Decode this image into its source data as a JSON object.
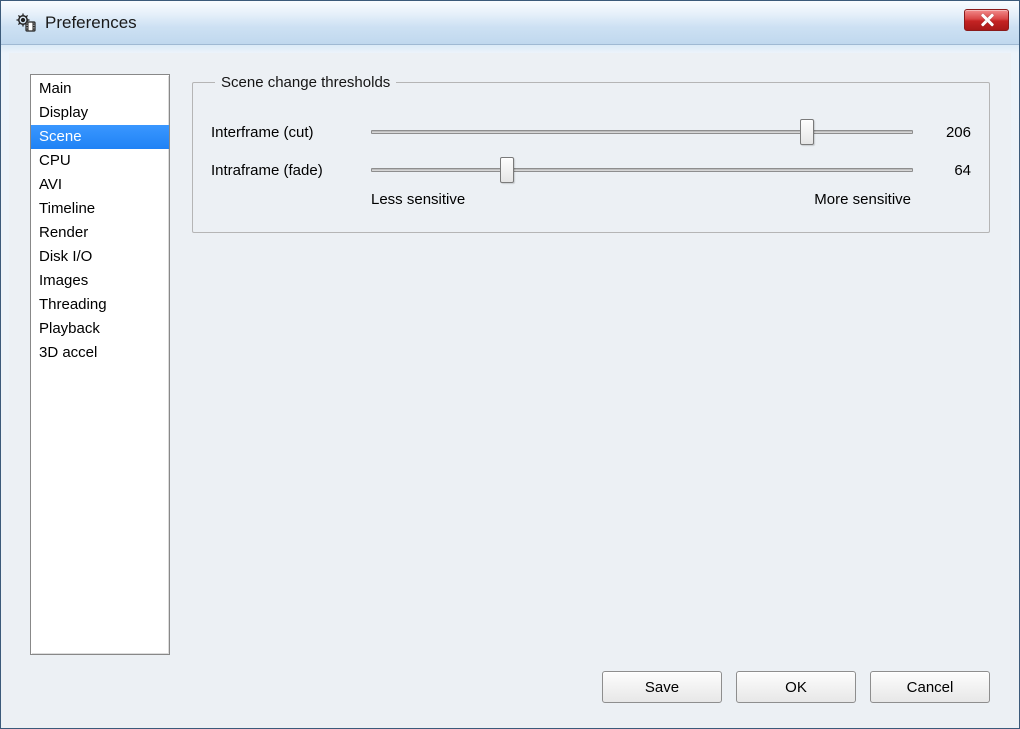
{
  "window": {
    "title": "Preferences"
  },
  "sidebar": {
    "items": [
      {
        "label": "Main",
        "selected": false
      },
      {
        "label": "Display",
        "selected": false
      },
      {
        "label": "Scene",
        "selected": true
      },
      {
        "label": "CPU",
        "selected": false
      },
      {
        "label": "AVI",
        "selected": false
      },
      {
        "label": "Timeline",
        "selected": false
      },
      {
        "label": "Render",
        "selected": false
      },
      {
        "label": "Disk I/O",
        "selected": false
      },
      {
        "label": "Images",
        "selected": false
      },
      {
        "label": "Threading",
        "selected": false
      },
      {
        "label": "Playback",
        "selected": false
      },
      {
        "label": "3D accel",
        "selected": false
      }
    ]
  },
  "group": {
    "legend": "Scene change thresholds",
    "sliders": [
      {
        "label": "Interframe (cut)",
        "value": 206,
        "min": 0,
        "max": 256
      },
      {
        "label": "Intraframe (fade)",
        "value": 64,
        "min": 0,
        "max": 256
      }
    ],
    "hint_left": "Less sensitive",
    "hint_right": "More sensitive"
  },
  "buttons": {
    "save": "Save",
    "ok": "OK",
    "cancel": "Cancel"
  }
}
